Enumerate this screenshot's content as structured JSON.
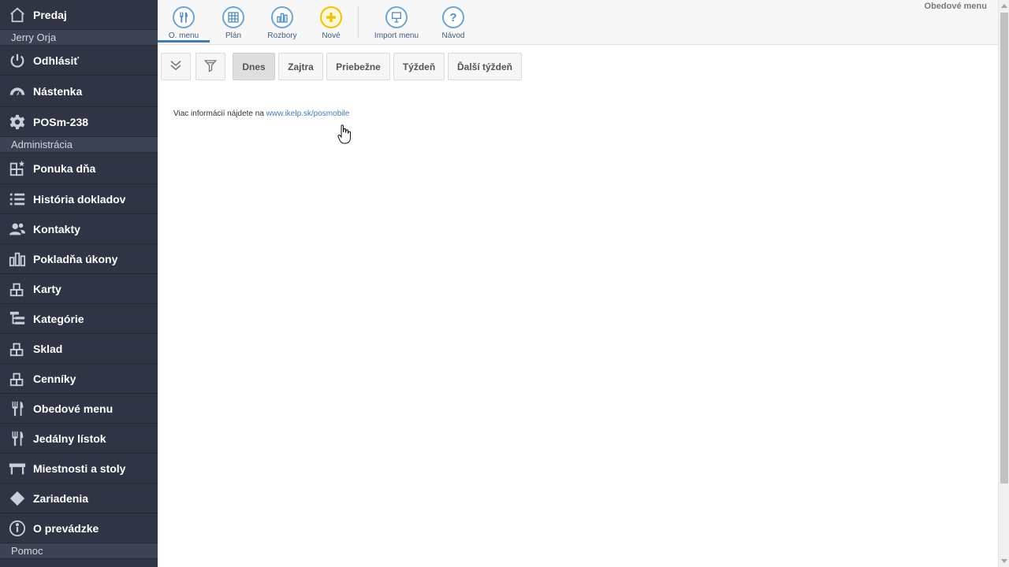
{
  "sidebar": {
    "top": {
      "label": "Predaj",
      "icon": "home-icon"
    },
    "user_section": "Jerry Orja",
    "user_items": [
      {
        "label": "Odhlásiť",
        "icon": "power-icon"
      },
      {
        "label": "Nástenka",
        "icon": "dashboard-icon"
      },
      {
        "label": "POSm-238",
        "icon": "gear-icon"
      }
    ],
    "admin_section": "Administrácia",
    "admin_items": [
      {
        "label": "Ponuka dňa",
        "icon": "boxes-star-icon"
      },
      {
        "label": "História dokladov",
        "icon": "list-icon"
      },
      {
        "label": "Kontakty",
        "icon": "users-icon"
      },
      {
        "label": "Pokladňa úkony",
        "icon": "bar-chart-icon"
      },
      {
        "label": "Karty",
        "icon": "boxes-icon"
      },
      {
        "label": "Kategórie",
        "icon": "tree-icon"
      },
      {
        "label": "Sklad",
        "icon": "boxes-icon"
      },
      {
        "label": "Cenníky",
        "icon": "boxes-icon"
      },
      {
        "label": "Obedové menu",
        "icon": "fork-knife-icon"
      },
      {
        "label": "Jedálny lístok",
        "icon": "fork-knife-icon"
      },
      {
        "label": "Miestnosti a stoly",
        "icon": "table-icon"
      },
      {
        "label": "Zariadenia",
        "icon": "diamond-icon"
      },
      {
        "label": "O prevádzke",
        "icon": "info-icon"
      }
    ],
    "help_section": "Pomoc"
  },
  "toolbar": {
    "page_title": "Obedové menu",
    "buttons": [
      {
        "label": "O. menu",
        "icon": "fork-knife-icon",
        "active": true
      },
      {
        "label": "Plán",
        "icon": "calendar-grid-icon"
      },
      {
        "label": "Rozbory",
        "icon": "bar-chart-icon"
      },
      {
        "label": "Nové",
        "icon": "plus-icon"
      },
      {
        "label": "Import menu",
        "icon": "import-icon"
      },
      {
        "label": "Návod",
        "icon": "help-icon"
      }
    ]
  },
  "filters": {
    "collapse_icon": "double-chevron-down-icon",
    "filter_icon": "funnel-icon",
    "tabs": [
      "Dnes",
      "Zajtra",
      "Priebežne",
      "Týždeň",
      "Ďalší týždeň"
    ],
    "selected": "Dnes"
  },
  "info": {
    "text": "Viac informácií nájdete na ",
    "link": "www.ikelp.sk/posmobile"
  },
  "colors": {
    "sidebar_bg": "#2f3544",
    "accent": "#3d7eb8",
    "new_button": "#f2c200"
  }
}
